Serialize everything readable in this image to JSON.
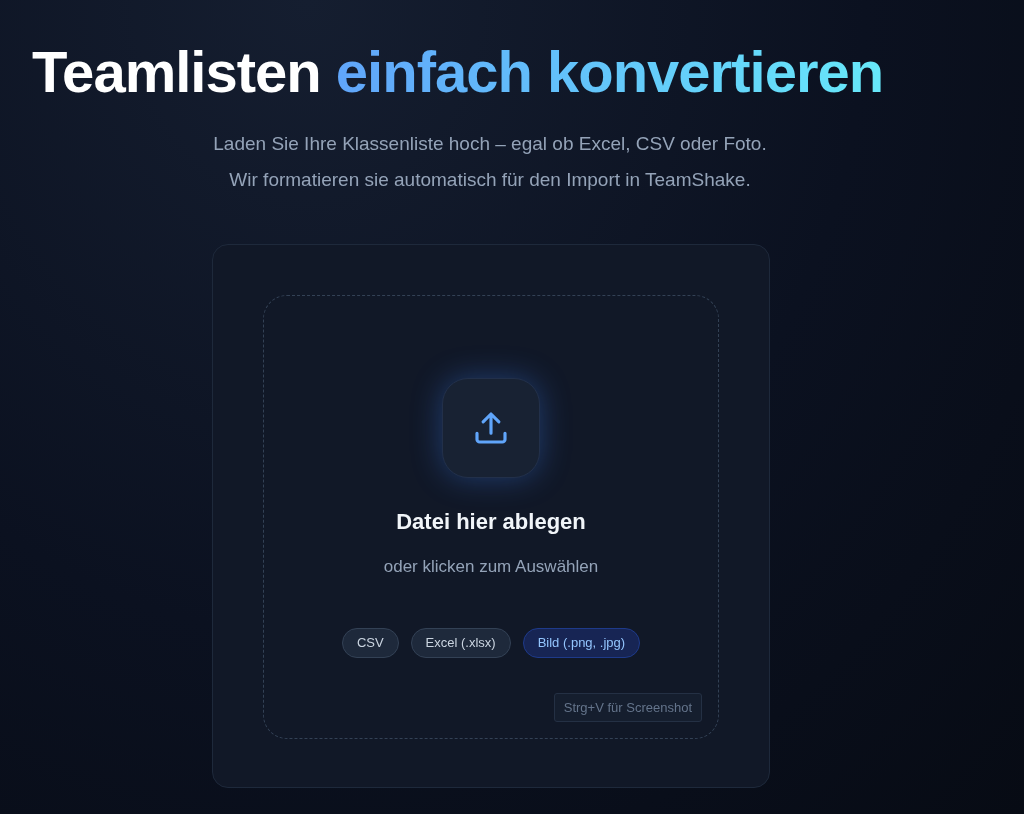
{
  "heading": {
    "plain": "Teamlisten",
    "highlight": "einfach konvertieren"
  },
  "intro": [
    "Laden Sie Ihre Klassenliste hoch – egal ob Excel, CSV oder Foto.",
    "Wir formatieren sie automatisch für den Import in TeamShake."
  ],
  "dropzone": {
    "title": "Datei hier ablegen",
    "subtitle": "oder klicken zum Auswählen",
    "formats": [
      {
        "label": "CSV",
        "selected": false
      },
      {
        "label": "Excel (.xlsx)",
        "selected": false
      },
      {
        "label": "Bild (.png, .jpg)",
        "selected": true
      }
    ],
    "shortcut": "Strg+V für Screenshot"
  }
}
